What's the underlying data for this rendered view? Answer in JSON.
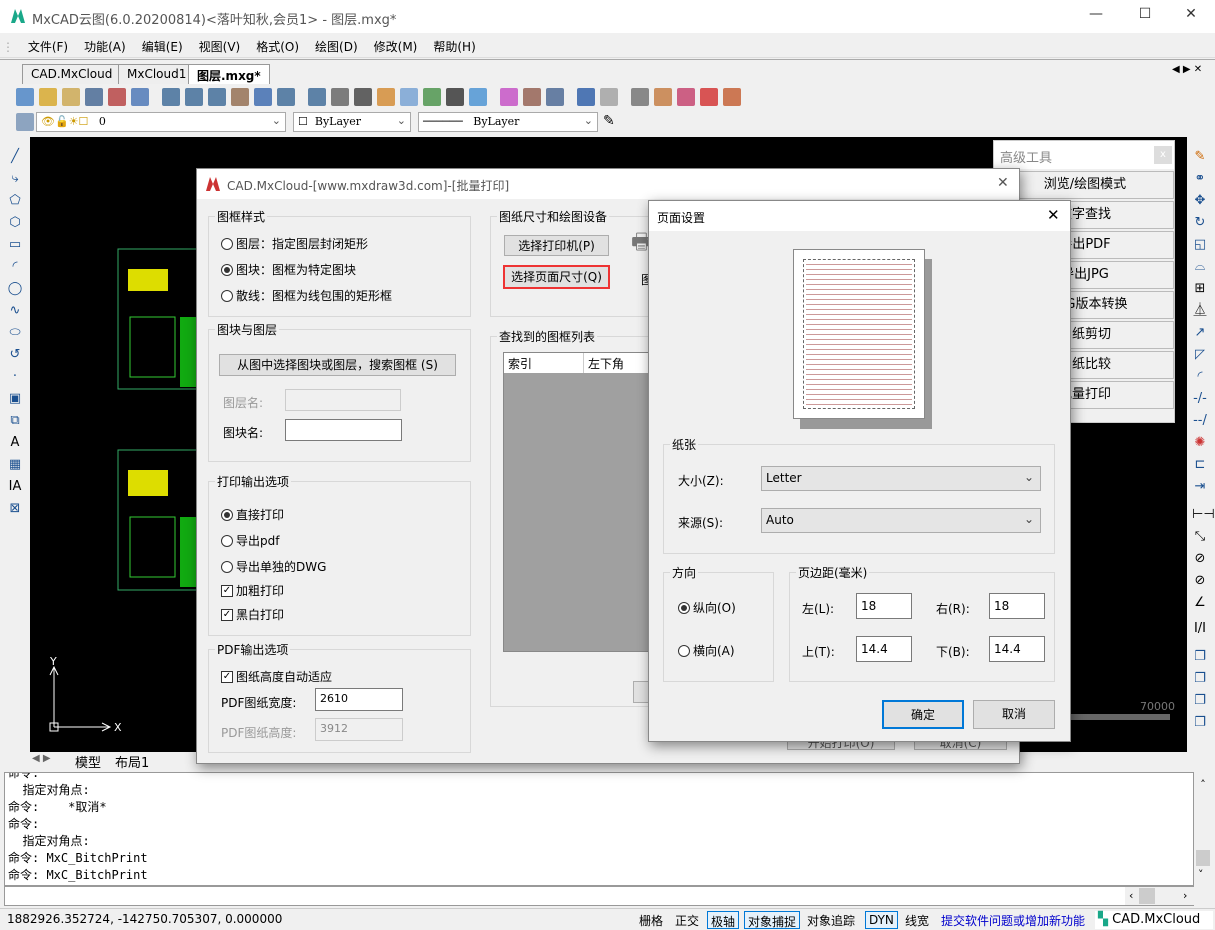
{
  "app": {
    "title": "MxCAD云图(6.0.20200814)<落叶知秋,会员1> - 图层.mxg*",
    "accent": "#0078d7",
    "logo_color": "#1aa889"
  },
  "menu": [
    "文件(F)",
    "功能(A)",
    "编辑(E)",
    "视图(V)",
    "格式(O)",
    "绘图(D)",
    "修改(M)",
    "帮助(H)"
  ],
  "doc_tabs": [
    "CAD.MxCloud",
    "MxCloud1",
    "图层.mxg*"
  ],
  "active_tab": "图层.mxg*",
  "toolbar_icons": [
    "new-icon",
    "open-icon",
    "open-folder-icon",
    "save-icon",
    "cloud-save-icon",
    "save-as-icon",
    "zoom-realtime-icon",
    "zoom-window-icon",
    "zoom-extents-icon",
    "pan-icon",
    "ucs-icon",
    "zoom-previous-icon",
    "zoom-in-icon",
    "zoom-out-icon",
    "move-icon",
    "sketch-icon",
    "palette-icon",
    "layers-color-icon",
    "linetype-icon",
    "export-icon",
    "color-icon",
    "match-prop-icon",
    "properties-icon",
    "undo-icon",
    "redo-icon",
    "print-icon",
    "render-icon",
    "color-wheel-icon",
    "pdf-icon",
    "image-icon"
  ],
  "props": {
    "layer": "0",
    "color": "ByLayer",
    "linetype": "ByLayer"
  },
  "model_tabs": [
    "模型",
    "布局1"
  ],
  "command_lines": [
    "命令:",
    "  指定对角点:",
    "命令:    *取消*",
    "命令:",
    "  指定对角点:",
    "命令: MxC_BitchPrint",
    "命令: MxC_BitchPrint"
  ],
  "status": {
    "coords": "1882926.352724,  -142750.705307,  0.000000",
    "toggles": [
      {
        "label": "栅格",
        "on": false
      },
      {
        "label": "正交",
        "on": false
      },
      {
        "label": "极轴",
        "on": true
      },
      {
        "label": "对象捕捉",
        "on": true
      },
      {
        "label": "对象追踪",
        "on": false
      },
      {
        "label": "DYN",
        "on": true
      },
      {
        "label": "线宽",
        "on": false
      }
    ],
    "link": "提交软件问题或增加新功能",
    "brand": "CAD.MxCloud"
  },
  "canvas": {
    "scale_label": "70000",
    "axis_x": "X",
    "axis_y": "Y"
  },
  "adv_tools": {
    "title": "高级工具",
    "close": "x",
    "items": [
      "浏览/绘图模式",
      "文字查找",
      "导出PDF",
      "导出JPG",
      "DWG版本转换",
      "图纸剪切",
      "图纸比较",
      "批量打印"
    ]
  },
  "batch": {
    "title": "CAD.MxCloud-[www.mxdraw3d.com]-[批量打印]",
    "frame_style": {
      "legend": "图框样式",
      "options": [
        "图层：指定图层封闭矩形",
        "图块：图框为特定图块",
        "散线：图框为线包围的矩形框"
      ],
      "selected": 1
    },
    "block_layer": {
      "legend": "图块与图层",
      "search_button": "从图中选择图块或图层，搜索图框 (S)",
      "layer_label": "图层名:",
      "layer_value": "",
      "block_label": "图块名:",
      "block_value": ""
    },
    "output": {
      "legend": "打印输出选项",
      "radios": [
        "直接打印",
        "导出pdf",
        "导出单独的DWG"
      ],
      "selected": 0,
      "checks": [
        {
          "label": "加粗打印",
          "checked": true
        },
        {
          "label": "黑白打印",
          "checked": true
        }
      ]
    },
    "pdf": {
      "legend": "PDF输出选项",
      "auto_height": {
        "label": "图纸高度自动适应",
        "checked": true
      },
      "width_label": "PDF图纸宽度:",
      "width_value": "2610",
      "height_label": "PDF图纸高度:",
      "height_value": "3912"
    },
    "device": {
      "legend": "图纸尺寸和绘图设备",
      "printer_button": "选择打印机(P)",
      "page_button": "选择页面尺寸(Q)",
      "partial_label": "图"
    },
    "list": {
      "legend": "查找到的图框列表",
      "columns": [
        "索引",
        "左下角"
      ]
    },
    "start_button": "开始打印(O)",
    "cancel_button": "取消(C)"
  },
  "page_setup": {
    "title": "页面设置",
    "paper": {
      "legend": "纸张",
      "size_label": "大小(Z):",
      "size_value": "Letter",
      "source_label": "来源(S):",
      "source_value": "Auto"
    },
    "orientation": {
      "legend": "方向",
      "options": [
        "纵向(O)",
        "横向(A)"
      ],
      "selected": 0
    },
    "margins": {
      "legend": "页边距(毫米)",
      "left_label": "左(L):",
      "left": "18",
      "right_label": "右(R):",
      "right": "18",
      "top_label": "上(T):",
      "top": "14.4",
      "bottom_label": "下(B):",
      "bottom": "14.4"
    },
    "ok": "确定",
    "cancel": "取消"
  }
}
